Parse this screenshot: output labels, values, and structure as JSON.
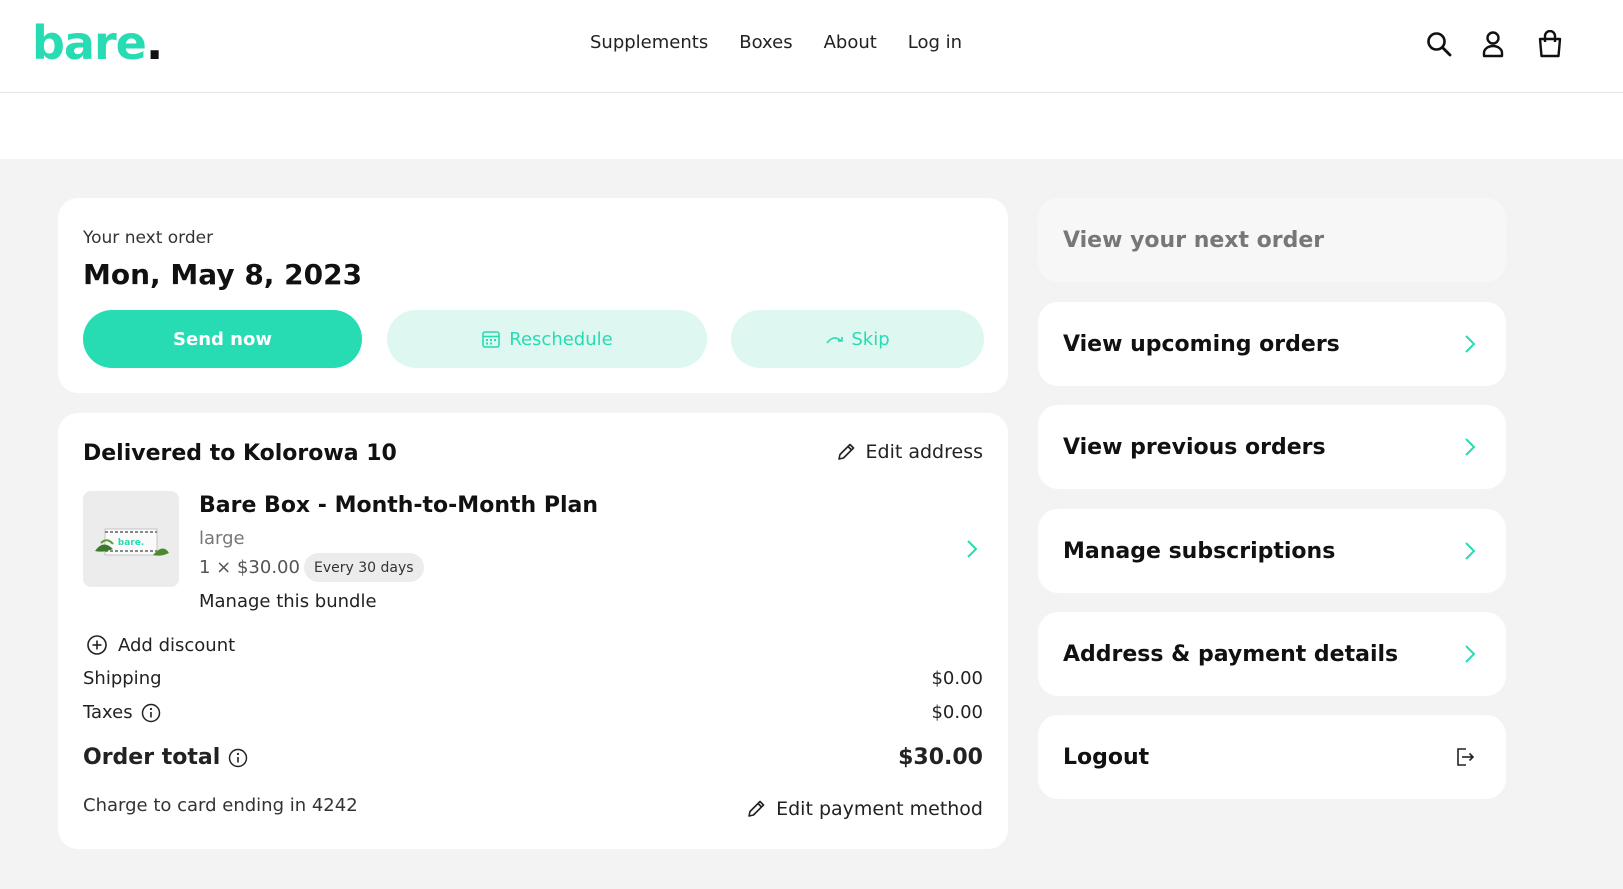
{
  "brand": {
    "logo_text": "bare",
    "logo_dot": ".",
    "accent_color": "#27dcb3"
  },
  "nav": {
    "items": [
      "Supplements",
      "Boxes",
      "About",
      "Log in"
    ]
  },
  "header_icons": [
    "search-icon",
    "account-icon",
    "cart-icon"
  ],
  "next_order": {
    "label": "Your next order",
    "date": "Mon, May 8, 2023",
    "send_now": "Send now",
    "reschedule": "Reschedule",
    "skip": "Skip"
  },
  "order": {
    "delivered_to": "Delivered to Kolorowa 10",
    "edit_address": "Edit address",
    "product": {
      "title": "Bare Box - Month-to-Month Plan",
      "variant": "large",
      "price_line": "1 × $30.00",
      "frequency": "Every 30 days",
      "manage": "Manage this bundle",
      "thumb_text": "bare."
    },
    "add_discount": "Add discount",
    "shipping_label": "Shipping",
    "shipping_value": "$0.00",
    "taxes_label": "Taxes",
    "taxes_value": "$0.00",
    "total_label": "Order total",
    "total_value": "$30.00",
    "charge_text": "Charge to card ending in 4242",
    "edit_payment": "Edit payment method"
  },
  "sidebar": {
    "items": [
      {
        "label": "View your next order"
      },
      {
        "label": "View upcoming orders"
      },
      {
        "label": "View previous orders"
      },
      {
        "label": "Manage subscriptions"
      },
      {
        "label": "Address & payment details"
      },
      {
        "label": "Logout"
      }
    ]
  }
}
